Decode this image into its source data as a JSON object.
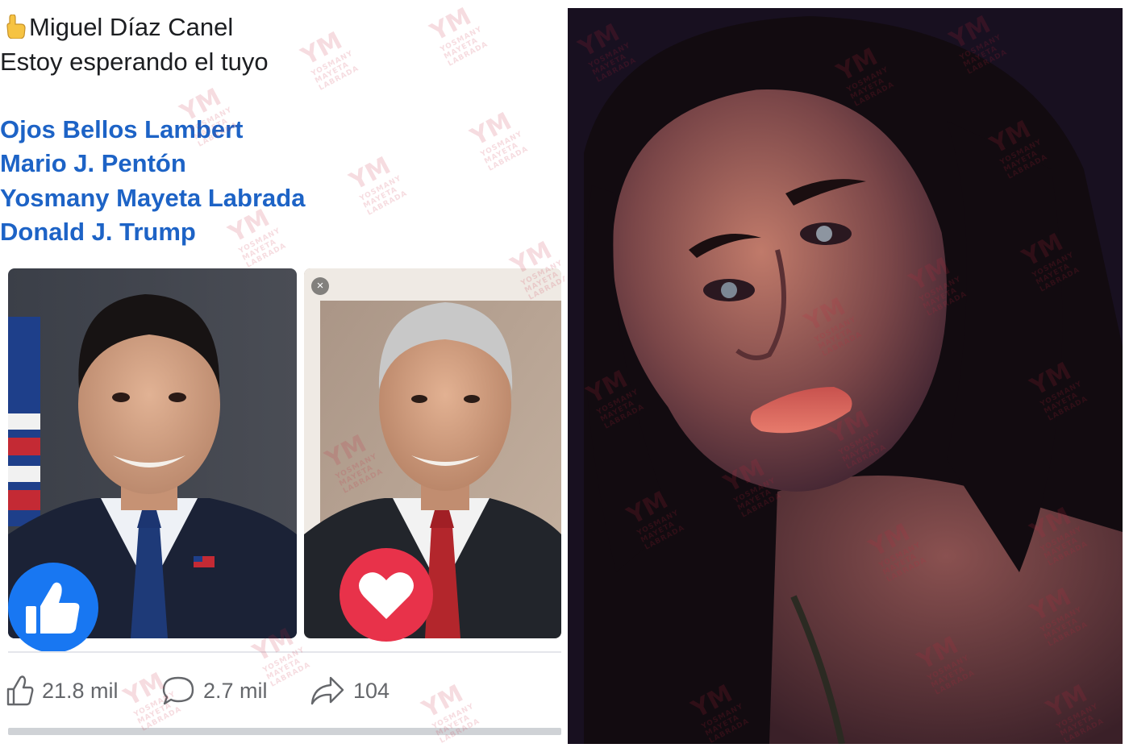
{
  "post": {
    "author_line": "Miguel Díaz Canel",
    "message": "Estoy esperando el tuyo",
    "tags": [
      "Ojos Bellos Lambert",
      "Mario J. Pentón",
      "Yosmany Mayeta Labrada",
      "Donald J. Trump"
    ],
    "close_symbol": "×",
    "stats": {
      "likes": "21.8 mil",
      "comments": "2.7 mil",
      "shares": "104"
    }
  },
  "watermark": {
    "logo": "YM",
    "line1": "YOSMANY",
    "line2": "MAYETA",
    "line3": "LABRADA"
  },
  "colors": {
    "mention_blue": "#1d63c6",
    "like_blue": "#1877f2",
    "love_red": "#e8324a",
    "watermark_red": "#c8283c"
  },
  "icons": {
    "like_stat": "thumbs-up-outline-icon",
    "comment_stat": "speech-bubble-icon",
    "share_stat": "share-arrow-icon",
    "like_reaction": "thumbs-up-icon",
    "love_reaction": "heart-icon",
    "emoji": "pointing-hand-emoji"
  }
}
